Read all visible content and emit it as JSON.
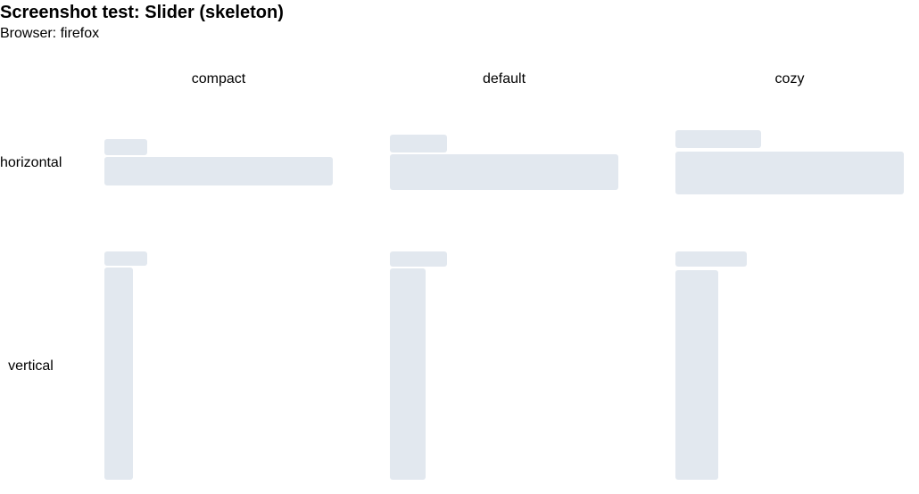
{
  "page": {
    "title": "Screenshot test: Slider (skeleton)",
    "subtitle": "Browser: firefox"
  },
  "columns": {
    "compact": "compact",
    "default": "default",
    "cozy": "cozy"
  },
  "rows": {
    "horizontal": "horizontal",
    "vertical": "vertical"
  },
  "colors": {
    "skeleton": "#e2e8ef"
  }
}
